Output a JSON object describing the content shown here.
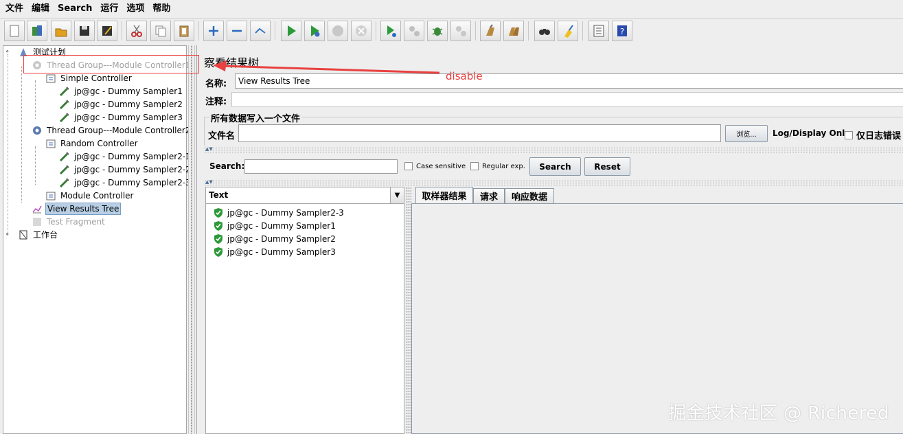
{
  "menubar": {
    "items": [
      "文件",
      "编辑",
      "Search",
      "运行",
      "选项",
      "帮助"
    ]
  },
  "toolbar": {
    "icons": [
      "new-icon",
      "templates-icon",
      "open-icon",
      "save-icon",
      "save-as-icon",
      "cut-icon",
      "copy-icon",
      "paste-icon",
      "expand-icon",
      "collapse-icon",
      "toggle-icon",
      "start-icon",
      "start-no-pause-icon",
      "stop-icon",
      "shutdown-icon",
      "remote-start-icon",
      "remote-stop-icon",
      "remote-shutdown-icon",
      "remote-exit-icon",
      "clear-icon",
      "clear-all-icon",
      "search-icon",
      "reset-search-icon",
      "function-helper-icon",
      "help-icon"
    ]
  },
  "tree": {
    "nodes": [
      {
        "label": "测试计划"
      },
      {
        "label": "Thread Group---Module Controller1"
      },
      {
        "label": "Simple Controller"
      },
      {
        "label": "jp@gc - Dummy Sampler1"
      },
      {
        "label": "jp@gc - Dummy Sampler2"
      },
      {
        "label": "jp@gc - Dummy Sampler3"
      },
      {
        "label": "Thread Group---Module Controller2"
      },
      {
        "label": "Random Controller"
      },
      {
        "label": "jp@gc - Dummy Sampler2-1"
      },
      {
        "label": "jp@gc - Dummy Sampler2-2"
      },
      {
        "label": "jp@gc - Dummy Sampler2-3"
      },
      {
        "label": "Module Controller"
      },
      {
        "label": "View Results Tree"
      },
      {
        "label": "Test Fragment"
      },
      {
        "label": "工作台"
      }
    ]
  },
  "panel": {
    "title": "察看结果树",
    "name_label": "名称:",
    "name_value": "View Results Tree",
    "comment_label": "注释:",
    "comment_value": "",
    "file_group_title": "所有数据写入一个文件",
    "filename_label": "文件名",
    "filename_value": "",
    "browse_label": "浏览...",
    "log_display_label": "Log/Display Only:",
    "errors_only_label": "仅日志错误"
  },
  "search": {
    "label": "Search:",
    "value": "",
    "case_sensitive_label": "Case sensitive",
    "regex_label": "Regular exp.",
    "search_button": "Search",
    "reset_button": "Reset"
  },
  "results": {
    "renderer": "Text",
    "items": [
      {
        "label": "jp@gc - Dummy Sampler2-3",
        "status": "success"
      },
      {
        "label": "jp@gc - Dummy Sampler1",
        "status": "success"
      },
      {
        "label": "jp@gc - Dummy Sampler2",
        "status": "success"
      },
      {
        "label": "jp@gc - Dummy Sampler3",
        "status": "success"
      }
    ]
  },
  "tabs": [
    {
      "label": "取样器结果",
      "active": true
    },
    {
      "label": "请求",
      "active": false
    },
    {
      "label": "响应数据",
      "active": false
    }
  ],
  "annotation": {
    "text": "disable",
    "color": "#e94040"
  },
  "watermark": "掘金技术社区 @ Richered",
  "colors": {
    "selection": "#b8cfe5",
    "disabled_text": "#a0a0a0",
    "success_green": "#2e9a3a"
  }
}
